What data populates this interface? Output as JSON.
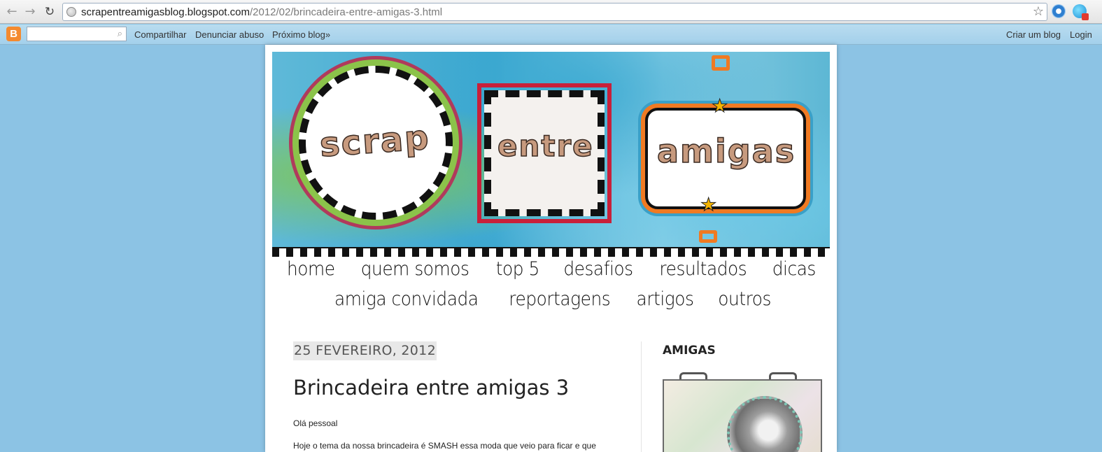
{
  "browser": {
    "url_host": "scrapentreamigasblog.blogspot.com",
    "url_path": "/2012/02/brincadeira-entre-amigas-3.html"
  },
  "blogger_bar": {
    "share": "Compartilhar",
    "report_abuse": "Denunciar abuso",
    "next_blog": "Próximo blog»",
    "create_blog": "Criar um blog",
    "login": "Login"
  },
  "header": {
    "word1": "scrap",
    "word2": "entre",
    "word3": "amigas"
  },
  "menu": {
    "row1": [
      "home",
      "quem somos",
      "top 5",
      "desafios",
      "resultados",
      "dicas"
    ],
    "row2": [
      "amiga convidada",
      "reportagens",
      "artigos",
      "outros"
    ]
  },
  "post": {
    "date": "25 FEVEREIRO, 2012",
    "title": "Brincadeira entre amigas 3",
    "paragraph1": "Olá pessoal",
    "paragraph2": "Hoje o tema da nossa brincadeira é SMASH essa moda que veio para ficar e que"
  },
  "sidebar": {
    "title": "AMIGAS"
  },
  "colors": {
    "page_background": "#8cc3e4",
    "blogger_bar": "#a3d0eb",
    "blogger_logo": "#f48a2f"
  }
}
